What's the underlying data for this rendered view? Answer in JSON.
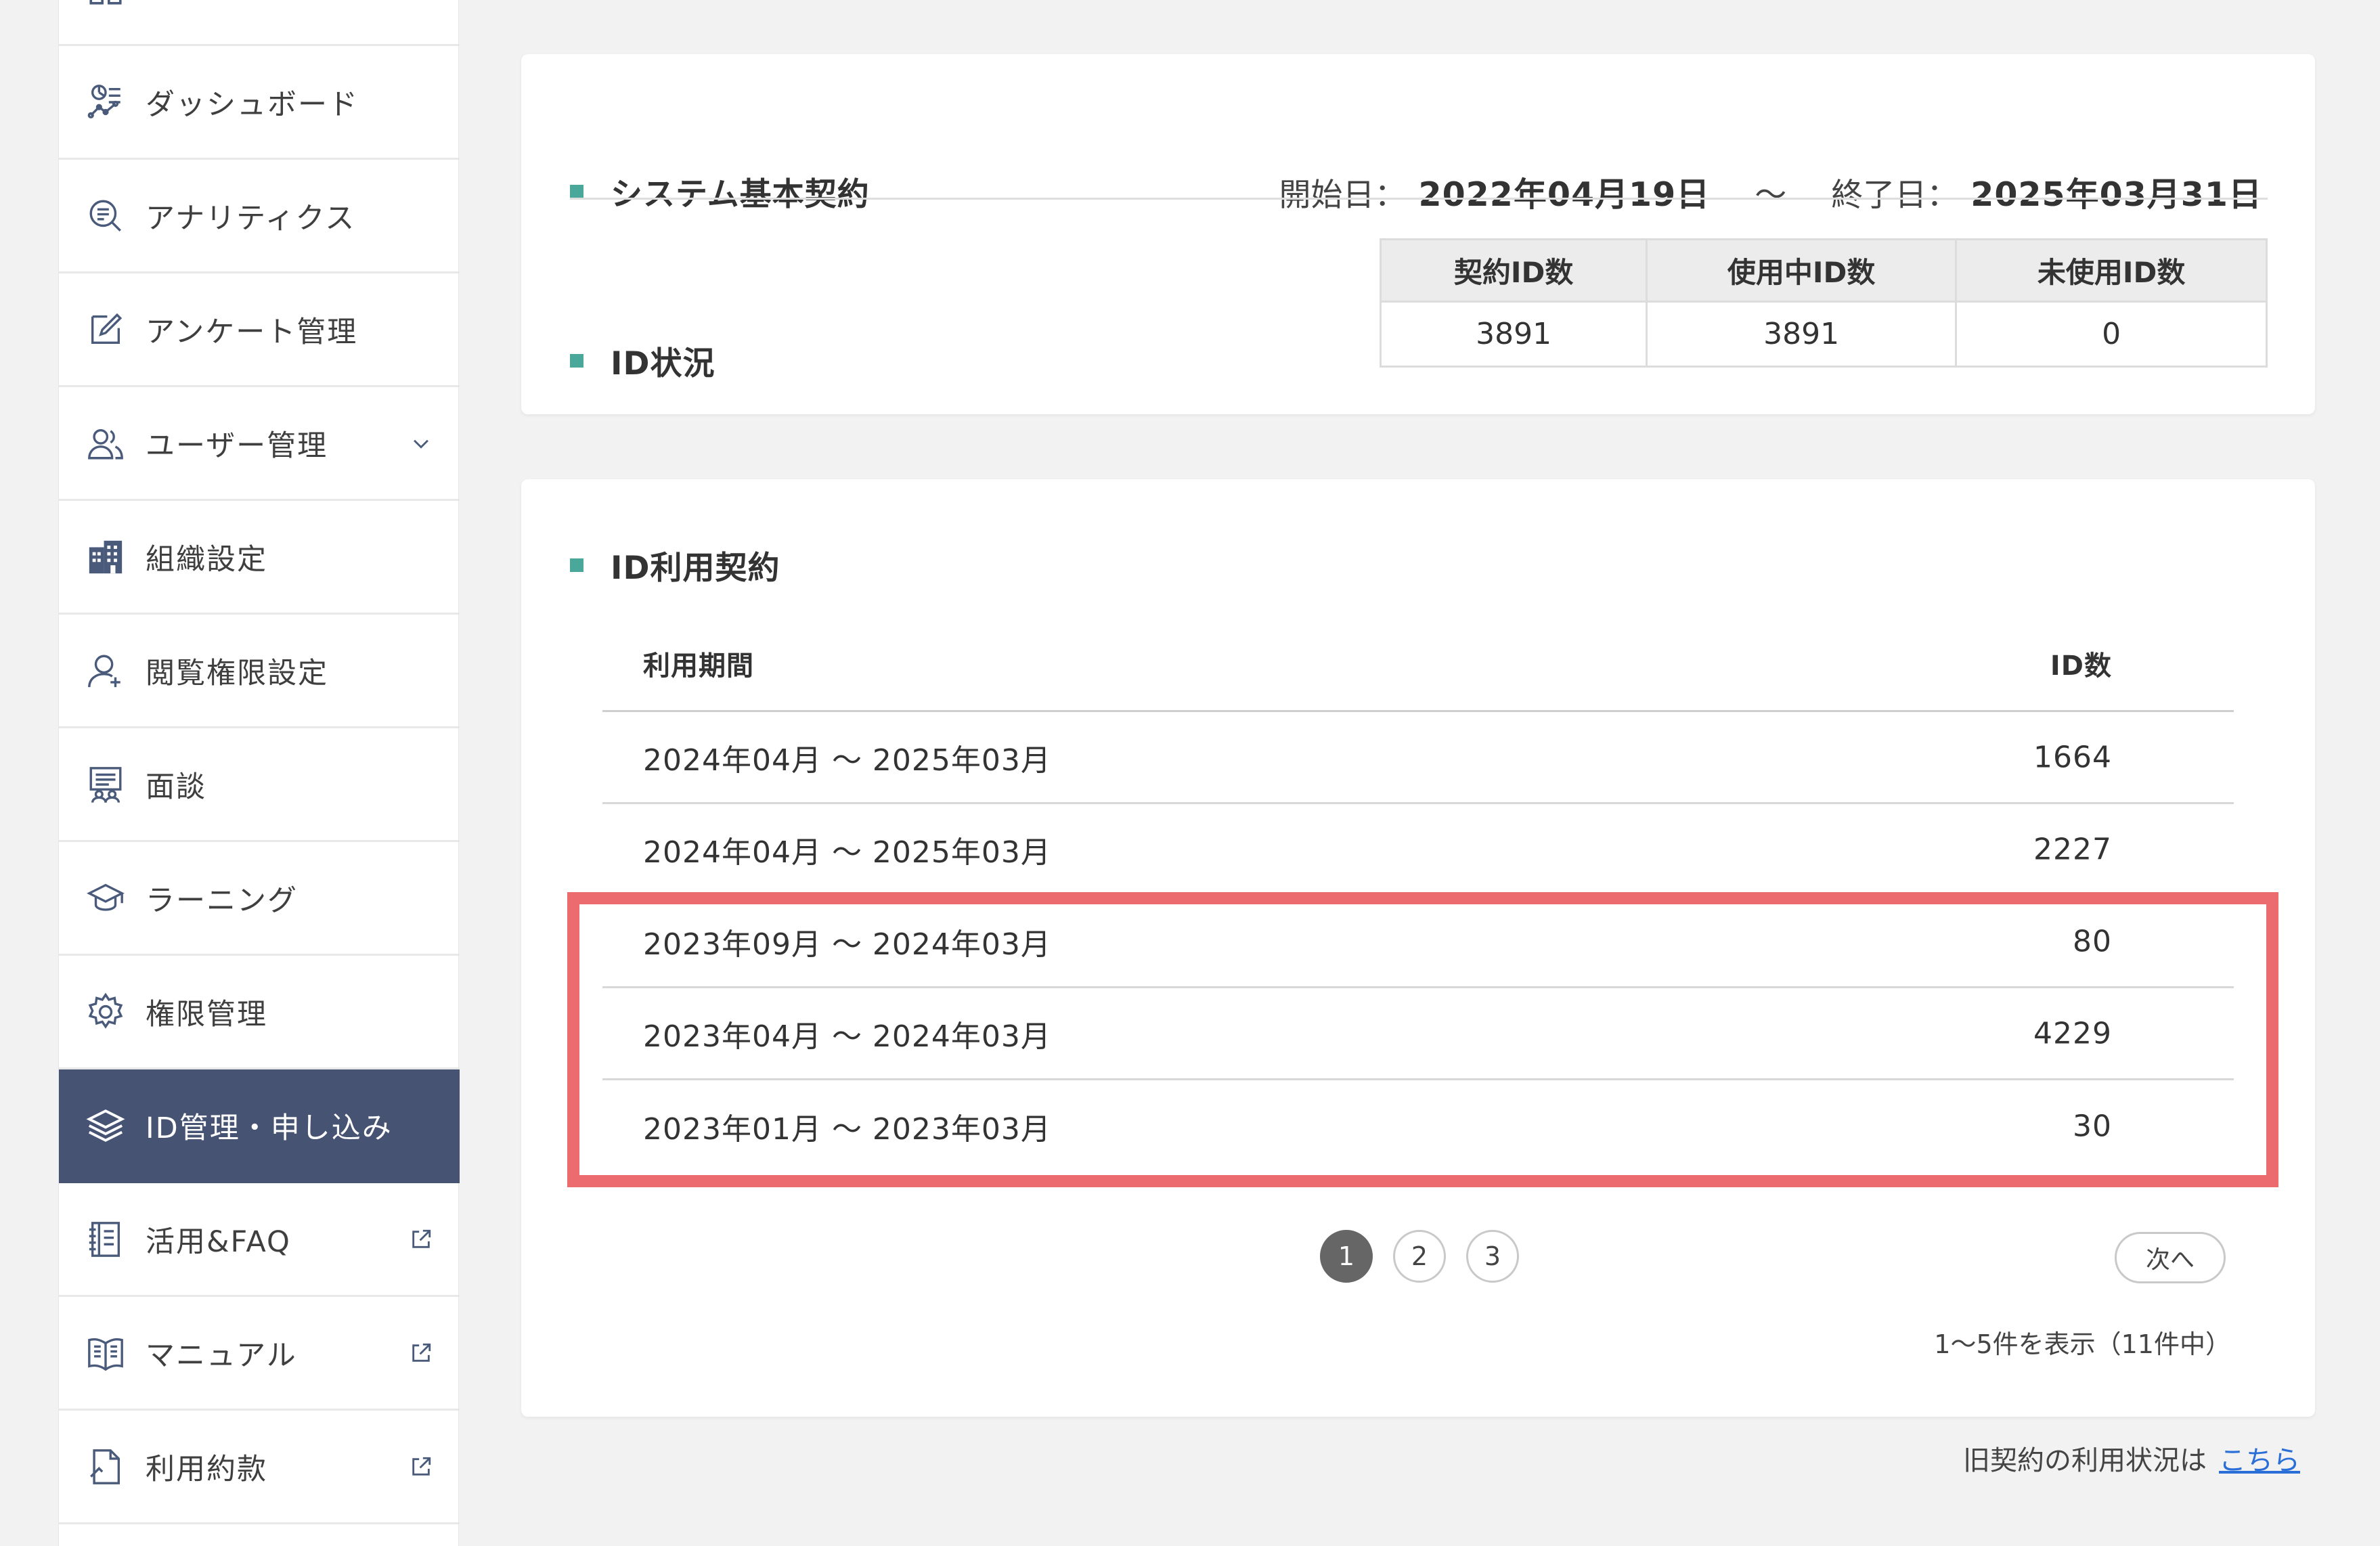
{
  "sidebar": {
    "items": [
      {
        "label": "",
        "icon": "grid-icon"
      },
      {
        "label": "ダッシュボード",
        "icon": "dashboard-icon"
      },
      {
        "label": "アナリティクス",
        "icon": "analytics-search-icon"
      },
      {
        "label": "アンケート管理",
        "icon": "edit-icon"
      },
      {
        "label": "ユーザー管理",
        "icon": "users-icon",
        "trail": "chevron-down-icon"
      },
      {
        "label": "組織設定",
        "icon": "building-icon"
      },
      {
        "label": "閲覧権限設定",
        "icon": "user-permission-icon"
      },
      {
        "label": "面談",
        "icon": "interview-icon"
      },
      {
        "label": "ラーニング",
        "icon": "graduation-cap-icon"
      },
      {
        "label": "権限管理",
        "icon": "gear-icon"
      },
      {
        "label": "ID管理・申し込み",
        "icon": "layers-icon",
        "active": true
      },
      {
        "label": "活用&FAQ",
        "icon": "notebook-icon",
        "trail": "external-link-icon"
      },
      {
        "label": "マニュアル",
        "icon": "book-icon",
        "trail": "external-link-icon"
      },
      {
        "label": "利用約款",
        "icon": "document-icon",
        "trail": "external-link-icon"
      }
    ]
  },
  "contract": {
    "title": "システム基本契約",
    "start_label": "開始日：",
    "start_value": "2022年04月19日",
    "tilde": "〜",
    "end_label": "終了日：",
    "end_value": "2025年03月31日"
  },
  "id_status": {
    "title": "ID状況",
    "headers": [
      "契約ID数",
      "使用中ID数",
      "未使用ID数"
    ],
    "values": [
      "3891",
      "3891",
      "0"
    ]
  },
  "id_usage": {
    "title": "ID利用契約",
    "col_period": "利用期間",
    "col_count": "ID数",
    "rows": [
      {
        "period": "2024年04月 〜 2025年03月",
        "count": "1664"
      },
      {
        "period": "2024年04月 〜 2025年03月",
        "count": "2227"
      },
      {
        "period": "2023年09月 〜 2024年03月",
        "count": "80"
      },
      {
        "period": "2023年04月 〜 2024年03月",
        "count": "4229"
      },
      {
        "period": "2023年01月 〜 2023年03月",
        "count": "30"
      }
    ]
  },
  "pagination": {
    "pages": [
      "1",
      "2",
      "3"
    ],
    "current": "1",
    "next_label": "次へ",
    "summary": "1〜5件を表示（11件中）"
  },
  "footer": {
    "note": "旧契約の利用状況は",
    "link": "こちら"
  },
  "colors": {
    "sidebar_active": "#465373",
    "accent_square": "#4aa89a",
    "highlight_border": "#ec6b6e",
    "link": "#2a6fd8"
  }
}
